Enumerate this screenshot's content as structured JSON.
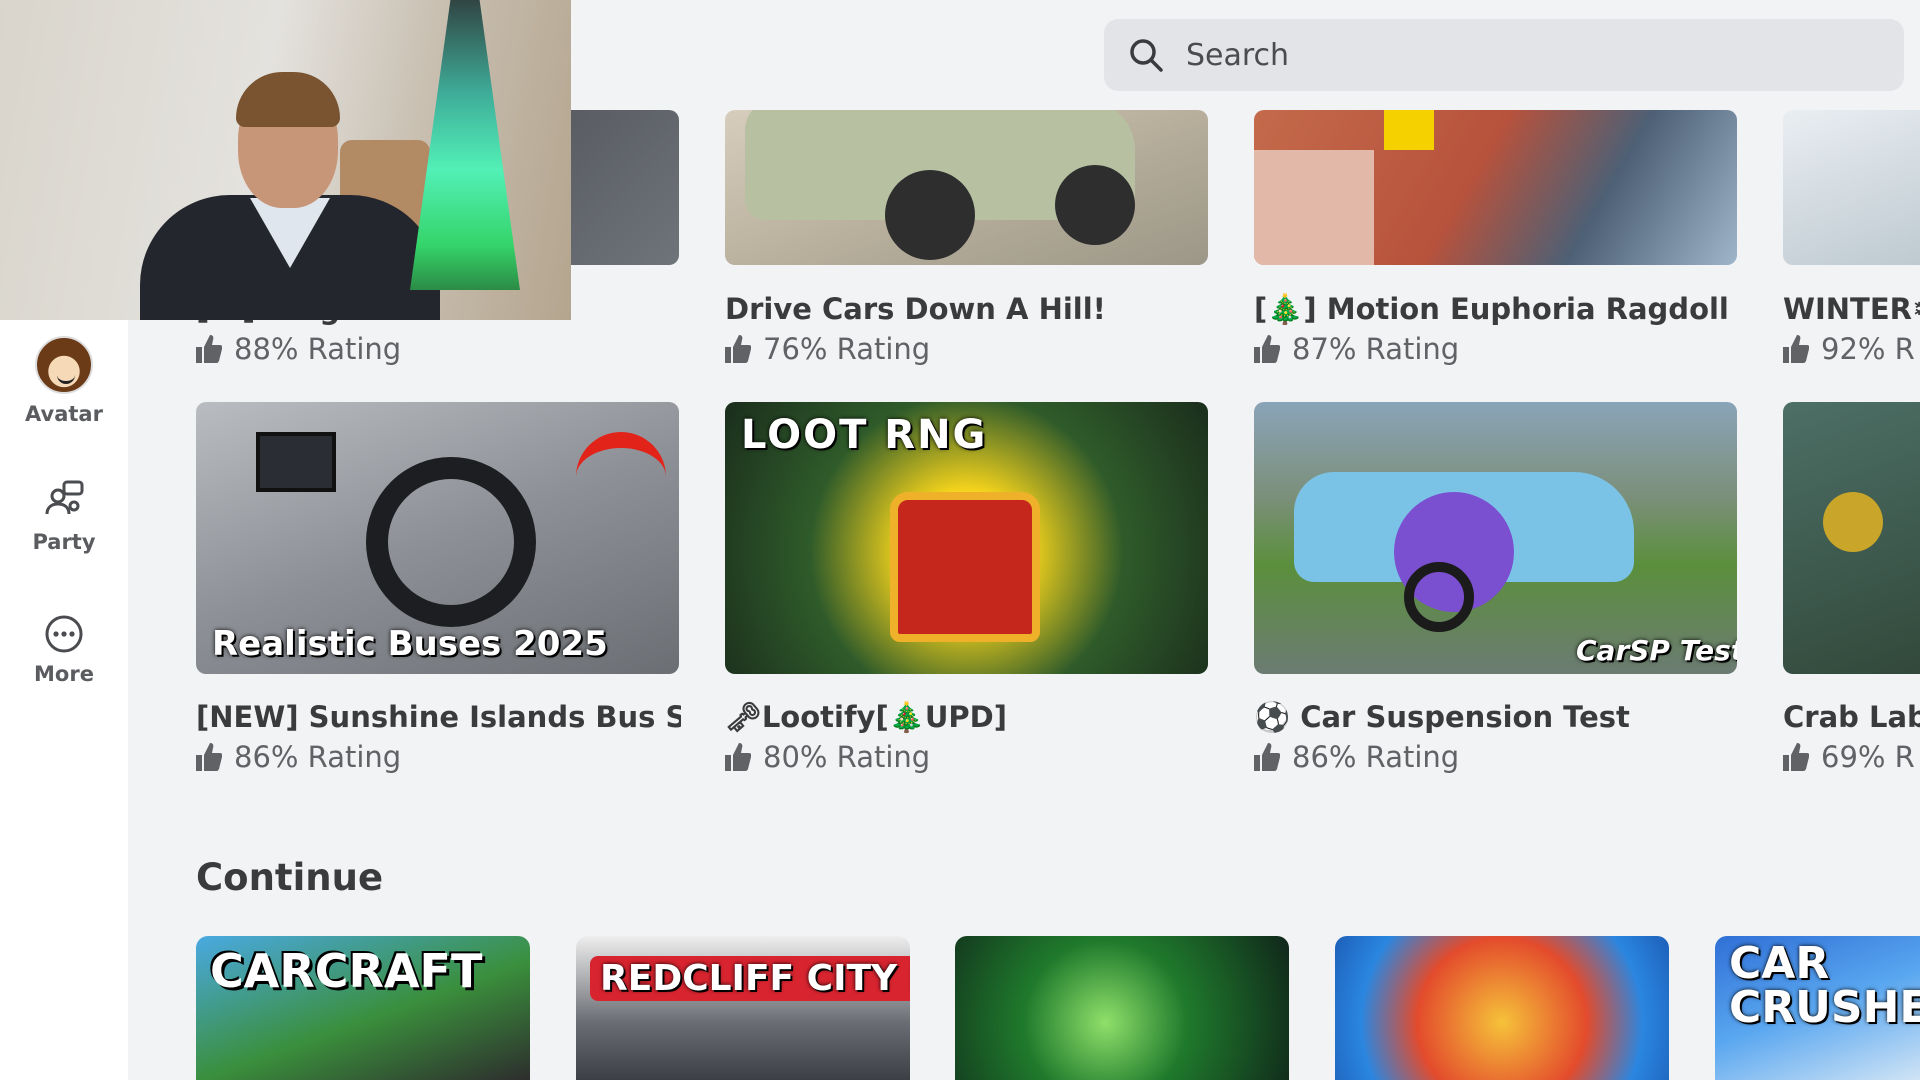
{
  "search": {
    "placeholder": "Search"
  },
  "sidebar": {
    "items": [
      {
        "label": "Avatar",
        "icon": "avatar-icon"
      },
      {
        "label": "Party",
        "icon": "party-icon"
      },
      {
        "label": "More",
        "icon": "more-icon"
      }
    ]
  },
  "games_row1": [
    {
      "title": "[...] ...ng Si...",
      "rating": "88% Rating"
    },
    {
      "title": "Drive Cars Down A Hill!",
      "rating": "76% Rating"
    },
    {
      "title": "[🎄] Motion Euphoria Ragdoll",
      "rating": "87% Rating"
    },
    {
      "title": "WINTER❄",
      "rating": "92% R"
    }
  ],
  "games_row2": [
    {
      "title": "[NEW] Sunshine Islands Bus S...",
      "rating": "86% Rating",
      "thumb_text": "Realistic Buses 2025"
    },
    {
      "title": "🗝Lootify[🎄UPD]",
      "rating": "80% Rating",
      "thumb_text": "LOOT RNG"
    },
    {
      "title": "⚽ Car Suspension Test",
      "rating": "86% Rating",
      "thumb_text": "CarSP Test"
    },
    {
      "title": "Crab Lab",
      "rating": "69% R"
    }
  ],
  "continue": {
    "heading": "Continue",
    "items": [
      {
        "thumb_text": "CARCRAFT"
      },
      {
        "thumb_text": "REDCLIFF CITY RP"
      },
      {
        "thumb_text": ""
      },
      {
        "thumb_text": ""
      },
      {
        "thumb_text": "CAR CRUSHE"
      }
    ]
  },
  "colors": {
    "background": "#f2f3f5",
    "sidebar": "#ffffff",
    "search": "#e3e4e7",
    "text": "#393b3d"
  }
}
